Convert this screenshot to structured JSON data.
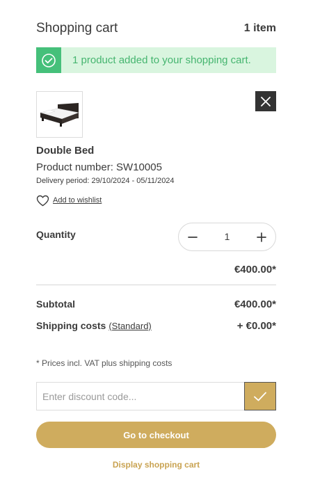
{
  "header": {
    "title": "Shopping cart",
    "item_count": "1 item"
  },
  "alert": {
    "message": "1 product added to your shopping cart.",
    "icon": "check-circle-icon",
    "color": "#45c07a",
    "background": "#d9f5df"
  },
  "product": {
    "image_icon": "bed-icon",
    "name": "Double Bed",
    "number": "Product number: SW10005",
    "delivery": "Delivery period: 29/10/2024 - 05/11/2024",
    "wishlist_label": "Add to wishlist",
    "remove_icon": "close-icon",
    "quantity_label": "Quantity",
    "quantity": "1",
    "line_price": "€400.00*"
  },
  "summary": {
    "subtotal_label": "Subtotal",
    "subtotal_value": "€400.00*",
    "shipping_label": "Shipping costs",
    "shipping_method": "(Standard)",
    "shipping_value": "+ €0.00*"
  },
  "vat_note": "* Prices incl. VAT plus shipping costs",
  "discount": {
    "placeholder": "Enter discount code...",
    "value": "",
    "submit_icon": "checkmark-icon"
  },
  "actions": {
    "checkout_label": "Go to checkout",
    "display_cart_label": "Display shopping cart"
  },
  "colors": {
    "accent": "#cfac5e",
    "dark": "#333333"
  }
}
